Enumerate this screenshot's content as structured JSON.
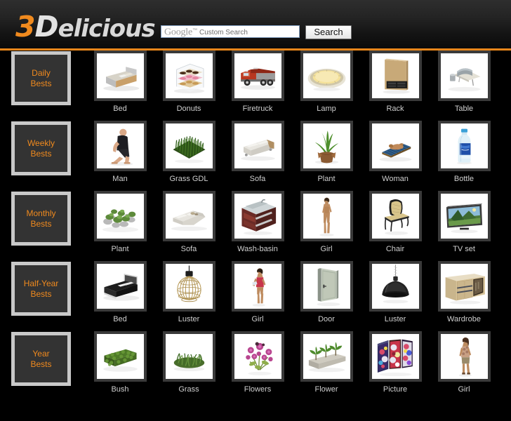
{
  "site": {
    "logo_prefix": "3",
    "logo_d": "D",
    "logo_rest": "elicious"
  },
  "search": {
    "brand": "Google",
    "tm": "™",
    "placeholder_suffix": "Custom Search",
    "value": "",
    "button_label": "Search"
  },
  "colors": {
    "accent": "#f08a1e",
    "divider": "#e8861b",
    "background": "#000000",
    "frame": "#3a3a3a",
    "caption": "#cfcfcf",
    "category_border": "#c9c9c9",
    "category_fill": "#333333"
  },
  "rows": [
    {
      "category": {
        "line1": "Daily",
        "line2": "Bests"
      },
      "items": [
        {
          "label": "Bed",
          "art": "bed-light"
        },
        {
          "label": "Donuts",
          "art": "donuts"
        },
        {
          "label": "Firetruck",
          "art": "firetruck"
        },
        {
          "label": "Lamp",
          "art": "lamp"
        },
        {
          "label": "Rack",
          "art": "rack"
        },
        {
          "label": "Table",
          "art": "table"
        }
      ]
    },
    {
      "category": {
        "line1": "Weekly",
        "line2": "Bests"
      },
      "items": [
        {
          "label": "Man",
          "art": "man"
        },
        {
          "label": "Grass GDL",
          "art": "grass-gdl"
        },
        {
          "label": "Sofa",
          "art": "sofa-white"
        },
        {
          "label": "Plant",
          "art": "plant-aloe"
        },
        {
          "label": "Woman",
          "art": "woman"
        },
        {
          "label": "Bottle",
          "art": "bottle"
        }
      ]
    },
    {
      "category": {
        "line1": "Monthly",
        "line2": "Bests"
      },
      "items": [
        {
          "label": "Plant",
          "art": "plant-rocks"
        },
        {
          "label": "Sofa",
          "art": "sofa-sectional"
        },
        {
          "label": "Wash-basin",
          "art": "wash-basin"
        },
        {
          "label": "Girl",
          "art": "girl-standing"
        },
        {
          "label": "Chair",
          "art": "chair"
        },
        {
          "label": "TV set",
          "art": "tv-set"
        }
      ]
    },
    {
      "category": {
        "line1": "Half-Year",
        "line2": "Bests"
      },
      "items": [
        {
          "label": "Bed",
          "art": "bed-dark"
        },
        {
          "label": "Luster",
          "art": "luster-cage"
        },
        {
          "label": "Girl",
          "art": "girl-red"
        },
        {
          "label": "Door",
          "art": "door"
        },
        {
          "label": "Luster",
          "art": "luster-dome"
        },
        {
          "label": "Wardrobe",
          "art": "wardrobe"
        }
      ]
    },
    {
      "category": {
        "line1": "Year",
        "line2": "Bests"
      },
      "items": [
        {
          "label": "Bush",
          "art": "bush"
        },
        {
          "label": "Grass",
          "art": "grass"
        },
        {
          "label": "Flowers",
          "art": "flowers"
        },
        {
          "label": "Flower",
          "art": "flower-box"
        },
        {
          "label": "Picture",
          "art": "picture"
        },
        {
          "label": "Girl",
          "art": "girl-walking"
        }
      ]
    }
  ]
}
